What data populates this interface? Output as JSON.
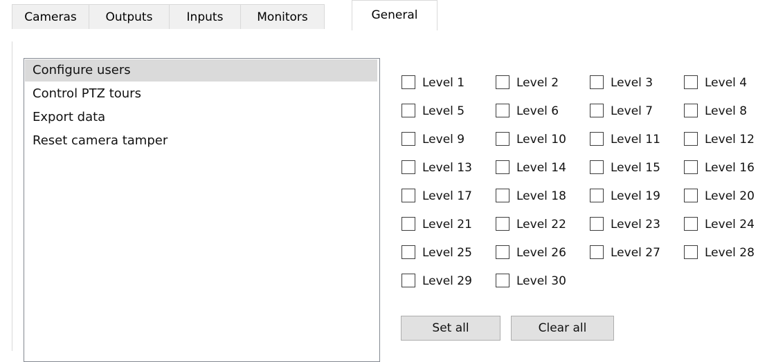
{
  "tabs": [
    {
      "label": "Cameras"
    },
    {
      "label": "Outputs"
    },
    {
      "label": "Inputs"
    },
    {
      "label": "Monitors"
    },
    {
      "label": "General"
    }
  ],
  "active_tab": "General",
  "permissions": {
    "items": [
      {
        "label": "Configure users",
        "selected": true
      },
      {
        "label": "Control PTZ tours",
        "selected": false
      },
      {
        "label": "Export data",
        "selected": false
      },
      {
        "label": "Reset camera tamper",
        "selected": false
      }
    ]
  },
  "levels": [
    {
      "label": "Level 1",
      "checked": false
    },
    {
      "label": "Level 2",
      "checked": false
    },
    {
      "label": "Level 3",
      "checked": false
    },
    {
      "label": "Level 4",
      "checked": false
    },
    {
      "label": "Level 5",
      "checked": false
    },
    {
      "label": "Level 6",
      "checked": false
    },
    {
      "label": "Level 7",
      "checked": false
    },
    {
      "label": "Level 8",
      "checked": false
    },
    {
      "label": "Level 9",
      "checked": false
    },
    {
      "label": "Level 10",
      "checked": false
    },
    {
      "label": "Level 11",
      "checked": false
    },
    {
      "label": "Level 12",
      "checked": false
    },
    {
      "label": "Level 13",
      "checked": false
    },
    {
      "label": "Level 14",
      "checked": false
    },
    {
      "label": "Level 15",
      "checked": false
    },
    {
      "label": "Level 16",
      "checked": false
    },
    {
      "label": "Level 17",
      "checked": false
    },
    {
      "label": "Level 18",
      "checked": false
    },
    {
      "label": "Level 19",
      "checked": false
    },
    {
      "label": "Level 20",
      "checked": false
    },
    {
      "label": "Level 21",
      "checked": false
    },
    {
      "label": "Level 22",
      "checked": false
    },
    {
      "label": "Level 23",
      "checked": false
    },
    {
      "label": "Level 24",
      "checked": false
    },
    {
      "label": "Level 25",
      "checked": false
    },
    {
      "label": "Level 26",
      "checked": false
    },
    {
      "label": "Level 27",
      "checked": false
    },
    {
      "label": "Level 28",
      "checked": false
    },
    {
      "label": "Level 29",
      "checked": false
    },
    {
      "label": "Level 30",
      "checked": false
    }
  ],
  "buttons": {
    "set_all": "Set all",
    "clear_all": "Clear all"
  }
}
